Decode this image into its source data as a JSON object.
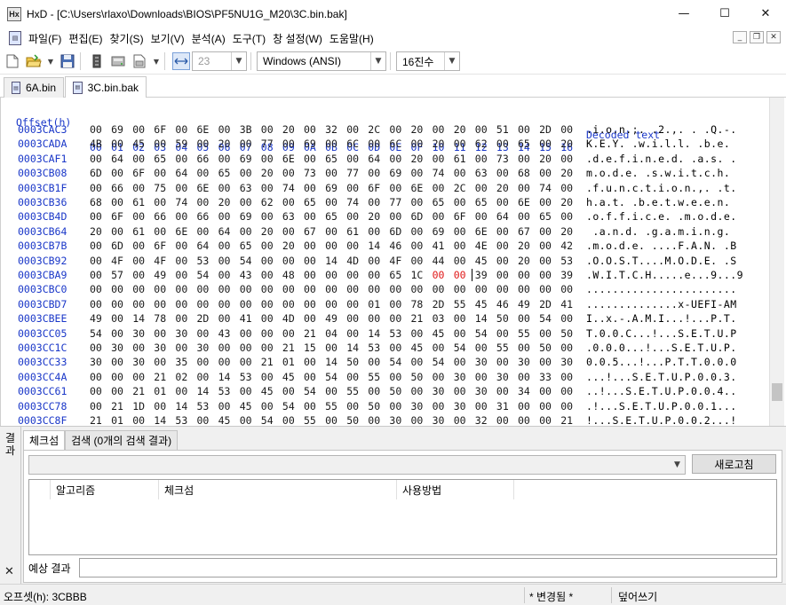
{
  "window": {
    "app_name": "HxD",
    "title": "HxD - [C:\\Users\\rlaxo\\Downloads\\BIOS\\PF5NU1G_M20\\3C.bin.bak]",
    "minimize_glyph": "—",
    "maximize_glyph": "☐",
    "close_glyph": "✕"
  },
  "menu": {
    "items": [
      "파일(F)",
      "편집(E)",
      "찾기(S)",
      "보기(V)",
      "분석(A)",
      "도구(T)",
      "창 설정(W)",
      "도움말(H)"
    ]
  },
  "toolbar": {
    "bytes_per_row": "23",
    "charset": "Windows (ANSI)",
    "offset_base": "16진수"
  },
  "tabs": [
    {
      "label": "6A.bin",
      "active": false
    },
    {
      "label": "3C.bin.bak",
      "active": true
    }
  ],
  "hex": {
    "offset_header": "Offset(h)",
    "columns": [
      "00",
      "01",
      "02",
      "03",
      "04",
      "05",
      "06",
      "07",
      "08",
      "09",
      "0A",
      "0B",
      "0C",
      "0D",
      "0E",
      "0F",
      "10",
      "11",
      "12",
      "13",
      "14",
      "15",
      "16"
    ],
    "decoded_header": "Decoded text",
    "rows": [
      {
        "offset": "0003CAC3",
        "bytes": [
          "00",
          "69",
          "00",
          "6F",
          "00",
          "6E",
          "00",
          "3B",
          "00",
          "20",
          "00",
          "32",
          "00",
          "2C",
          "00",
          "20",
          "00",
          "20",
          "00",
          "51",
          "00",
          "2D",
          "00"
        ],
        "ascii": ".i.o.n.;. .2.,. . .Q.-."
      },
      {
        "offset": "0003CADA",
        "bytes": [
          "4B",
          "00",
          "45",
          "00",
          "59",
          "00",
          "20",
          "00",
          "77",
          "00",
          "69",
          "00",
          "6C",
          "00",
          "6C",
          "00",
          "20",
          "00",
          "62",
          "00",
          "65",
          "00",
          "20"
        ],
        "ascii": "K.E.Y. .w.i.l.l. .b.e. "
      },
      {
        "offset": "0003CAF1",
        "bytes": [
          "00",
          "64",
          "00",
          "65",
          "00",
          "66",
          "00",
          "69",
          "00",
          "6E",
          "00",
          "65",
          "00",
          "64",
          "00",
          "20",
          "00",
          "61",
          "00",
          "73",
          "00",
          "20",
          "00"
        ],
        "ascii": ".d.e.f.i.n.e.d. .a.s. ."
      },
      {
        "offset": "0003CB08",
        "bytes": [
          "6D",
          "00",
          "6F",
          "00",
          "64",
          "00",
          "65",
          "00",
          "20",
          "00",
          "73",
          "00",
          "77",
          "00",
          "69",
          "00",
          "74",
          "00",
          "63",
          "00",
          "68",
          "00",
          "20"
        ],
        "ascii": "m.o.d.e. .s.w.i.t.c.h. "
      },
      {
        "offset": "0003CB1F",
        "bytes": [
          "00",
          "66",
          "00",
          "75",
          "00",
          "6E",
          "00",
          "63",
          "00",
          "74",
          "00",
          "69",
          "00",
          "6F",
          "00",
          "6E",
          "00",
          "2C",
          "00",
          "20",
          "00",
          "74",
          "00"
        ],
        "ascii": ".f.u.n.c.t.i.o.n.,. .t."
      },
      {
        "offset": "0003CB36",
        "bytes": [
          "68",
          "00",
          "61",
          "00",
          "74",
          "00",
          "20",
          "00",
          "62",
          "00",
          "65",
          "00",
          "74",
          "00",
          "77",
          "00",
          "65",
          "00",
          "65",
          "00",
          "6E",
          "00",
          "20"
        ],
        "ascii": "h.a.t. .b.e.t.w.e.e.n. "
      },
      {
        "offset": "0003CB4D",
        "bytes": [
          "00",
          "6F",
          "00",
          "66",
          "00",
          "66",
          "00",
          "69",
          "00",
          "63",
          "00",
          "65",
          "00",
          "20",
          "00",
          "6D",
          "00",
          "6F",
          "00",
          "64",
          "00",
          "65",
          "00"
        ],
        "ascii": ".o.f.f.i.c.e. .m.o.d.e."
      },
      {
        "offset": "0003CB64",
        "bytes": [
          "20",
          "00",
          "61",
          "00",
          "6E",
          "00",
          "64",
          "00",
          "20",
          "00",
          "67",
          "00",
          "61",
          "00",
          "6D",
          "00",
          "69",
          "00",
          "6E",
          "00",
          "67",
          "00",
          "20"
        ],
        "ascii": " .a.n.d. .g.a.m.i.n.g. "
      },
      {
        "offset": "0003CB7B",
        "bytes": [
          "00",
          "6D",
          "00",
          "6F",
          "00",
          "64",
          "00",
          "65",
          "00",
          "20",
          "00",
          "00",
          "00",
          "14",
          "46",
          "00",
          "41",
          "00",
          "4E",
          "00",
          "20",
          "00",
          "42"
        ],
        "ascii": ".m.o.d.e. ....F.A.N. .B"
      },
      {
        "offset": "0003CB92",
        "bytes": [
          "00",
          "4F",
          "00",
          "4F",
          "00",
          "53",
          "00",
          "54",
          "00",
          "00",
          "00",
          "14",
          "4D",
          "00",
          "4F",
          "00",
          "44",
          "00",
          "45",
          "00",
          "20",
          "00",
          "53"
        ],
        "ascii": ".O.O.S.T....M.O.D.E. .S"
      },
      {
        "offset": "0003CBA9",
        "bytes": [
          "00",
          "57",
          "00",
          "49",
          "00",
          "54",
          "00",
          "43",
          "00",
          "48",
          "00",
          "00",
          "00",
          "00",
          "65",
          "1C",
          "00",
          "00",
          "39",
          "00",
          "00",
          "00",
          "39"
        ],
        "ascii": ".W.I.T.C.H.....e...9...9",
        "red": [
          16,
          17
        ]
      },
      {
        "offset": "0003CBC0",
        "bytes": [
          "00",
          "00",
          "00",
          "00",
          "00",
          "00",
          "00",
          "00",
          "00",
          "00",
          "00",
          "00",
          "00",
          "00",
          "00",
          "00",
          "00",
          "00",
          "00",
          "00",
          "00",
          "00",
          "00"
        ],
        "ascii": "......................."
      },
      {
        "offset": "0003CBD7",
        "bytes": [
          "00",
          "00",
          "00",
          "00",
          "00",
          "00",
          "00",
          "00",
          "00",
          "00",
          "00",
          "00",
          "00",
          "01",
          "00",
          "78",
          "2D",
          "55",
          "45",
          "46",
          "49",
          "2D",
          "41",
          "4D"
        ],
        "ascii": "..............x-UEFI-AM"
      },
      {
        "offset": "0003CBEE",
        "bytes": [
          "49",
          "00",
          "14",
          "78",
          "00",
          "2D",
          "00",
          "41",
          "00",
          "4D",
          "00",
          "49",
          "00",
          "00",
          "00",
          "21",
          "03",
          "00",
          "14",
          "50",
          "00",
          "54",
          "00"
        ],
        "ascii": "I..x.-.A.M.I...!...P.T."
      },
      {
        "offset": "0003CC05",
        "bytes": [
          "54",
          "00",
          "30",
          "00",
          "30",
          "00",
          "43",
          "00",
          "00",
          "00",
          "21",
          "04",
          "00",
          "14",
          "53",
          "00",
          "45",
          "00",
          "54",
          "00",
          "55",
          "00",
          "50"
        ],
        "ascii": "T.0.0.C...!...S.E.T.U.P"
      },
      {
        "offset": "0003CC1C",
        "bytes": [
          "00",
          "30",
          "00",
          "30",
          "00",
          "30",
          "00",
          "00",
          "00",
          "21",
          "15",
          "00",
          "14",
          "53",
          "00",
          "45",
          "00",
          "54",
          "00",
          "55",
          "00",
          "50",
          "00"
        ],
        "ascii": ".0.0.0...!...S.E.T.U.P."
      },
      {
        "offset": "0003CC33",
        "bytes": [
          "30",
          "00",
          "30",
          "00",
          "35",
          "00",
          "00",
          "00",
          "21",
          "01",
          "00",
          "14",
          "50",
          "00",
          "54",
          "00",
          "54",
          "00",
          "30",
          "00",
          "30",
          "00",
          "30"
        ],
        "ascii": "0.0.5...!...P.T.T.0.0.0"
      },
      {
        "offset": "0003CC4A",
        "bytes": [
          "00",
          "00",
          "00",
          "21",
          "02",
          "00",
          "14",
          "53",
          "00",
          "45",
          "00",
          "54",
          "00",
          "55",
          "00",
          "50",
          "00",
          "30",
          "00",
          "30",
          "00",
          "33",
          "00"
        ],
        "ascii": "...!...S.E.T.U.P.0.0.3."
      },
      {
        "offset": "0003CC61",
        "bytes": [
          "00",
          "00",
          "21",
          "01",
          "00",
          "14",
          "53",
          "00",
          "45",
          "00",
          "54",
          "00",
          "55",
          "00",
          "50",
          "00",
          "30",
          "00",
          "30",
          "00",
          "34",
          "00",
          "00"
        ],
        "ascii": "..!...S.E.T.U.P.0.0.4.."
      },
      {
        "offset": "0003CC78",
        "bytes": [
          "00",
          "21",
          "1D",
          "00",
          "14",
          "53",
          "00",
          "45",
          "00",
          "54",
          "00",
          "55",
          "00",
          "50",
          "00",
          "30",
          "00",
          "30",
          "00",
          "31",
          "00",
          "00",
          "00"
        ],
        "ascii": ".!...S.E.T.U.P.0.0.1..."
      },
      {
        "offset": "0003CC8F",
        "bytes": [
          "21",
          "01",
          "00",
          "14",
          "53",
          "00",
          "45",
          "00",
          "54",
          "00",
          "55",
          "00",
          "50",
          "00",
          "30",
          "00",
          "30",
          "00",
          "32",
          "00",
          "00",
          "00",
          "21"
        ],
        "ascii": "!...S.E.T.U.P.0.0.2...!"
      }
    ]
  },
  "results_panel": {
    "side_label": "결과",
    "close_glyph": "✕",
    "tabs": [
      "체크섬",
      "검색 (0개의 검색 결과)"
    ],
    "refresh_button": "새로고침",
    "columns": [
      "알고리즘",
      "체크섬",
      "사용방법"
    ],
    "expected_label": "예상 결과"
  },
  "status": {
    "offset": "오프셋(h): 3CBBB",
    "modified": "* 변경됨 *",
    "mode": "덮어쓰기"
  },
  "colors": {
    "header_blue": "#1a37c8",
    "modified_red": "#e01818"
  },
  "icons": {
    "new": "new-file-icon",
    "open": "open-folder-icon",
    "save": "save-disk-icon",
    "ram": "ram-icon",
    "disk": "disk-icon",
    "image": "disk-image-icon",
    "autofit": "auto-fit-icon"
  }
}
